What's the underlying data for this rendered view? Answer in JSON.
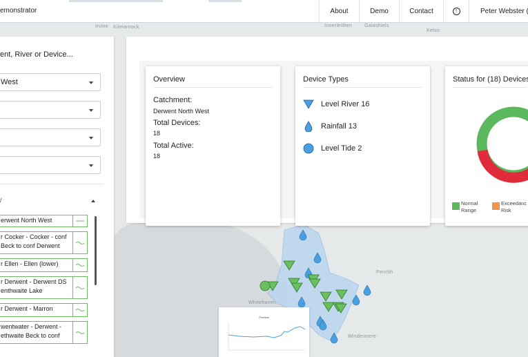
{
  "topbar": {
    "brand": "emonstrator",
    "nav": {
      "about": "About",
      "demo": "Demo",
      "contact": "Contact",
      "user": "Peter Webster (D"
    }
  },
  "map": {
    "labels": {
      "irvine": "Irvine",
      "kilmarnock": "Kilmarnock",
      "innerleithen": "Innerleithen",
      "galashiels": "Galashiels",
      "kelso": "Kelso",
      "penrith": "Penrith",
      "whitehaven": "Whitehaven",
      "windermere": "Windermere"
    }
  },
  "sidebar": {
    "search_heading": "ent, River or Device...",
    "selects": [
      "West",
      "",
      "",
      ""
    ],
    "section_label": "/",
    "devices": [
      {
        "name": "erwent North West"
      },
      {
        "name": "r Cocker - Cocker - conf Beck to conf Derwent"
      },
      {
        "name": "r Ellen - Ellen (lower)"
      },
      {
        "name": "r Derwent - Derwent DS enthwaite Lake"
      },
      {
        "name": "r Derwent - Marron"
      },
      {
        "name": "wentwater - Derwent - ethwaite Beck to conf"
      }
    ]
  },
  "overview": {
    "title": "Overview",
    "catchment_label": "Catchment:",
    "catchment_value": "Derwent North West",
    "total_devices_label": "Total Devices:",
    "total_devices_value": "18",
    "total_active_label": "Total Active:",
    "total_active_value": "18"
  },
  "device_types": {
    "title": "Device Types",
    "items": [
      {
        "label": "Level River  16",
        "icon": "triangle-down-icon"
      },
      {
        "label": "Rainfall  13",
        "icon": "raindrop-icon"
      },
      {
        "label": "Level Tide  2",
        "icon": "circle-icon"
      }
    ]
  },
  "status": {
    "title": "Status for (18) Devices",
    "legend": [
      {
        "label": "Normal Range",
        "line1": "Normal",
        "line2": "Range",
        "color": "#5cb85c"
      },
      {
        "label": "Exceedance Risk",
        "line1": "Exceedanc",
        "line2": "Risk",
        "color": "#f0954a"
      }
    ],
    "ring_colors": {
      "normal": "#5cb85c",
      "exceed": "#e02b3a"
    }
  },
  "popup": {
    "title": "Preview"
  },
  "colors": {
    "device_blue": "#4a9fe0",
    "device_green": "#6bbf5e",
    "catchment": "#b9d6ef"
  }
}
